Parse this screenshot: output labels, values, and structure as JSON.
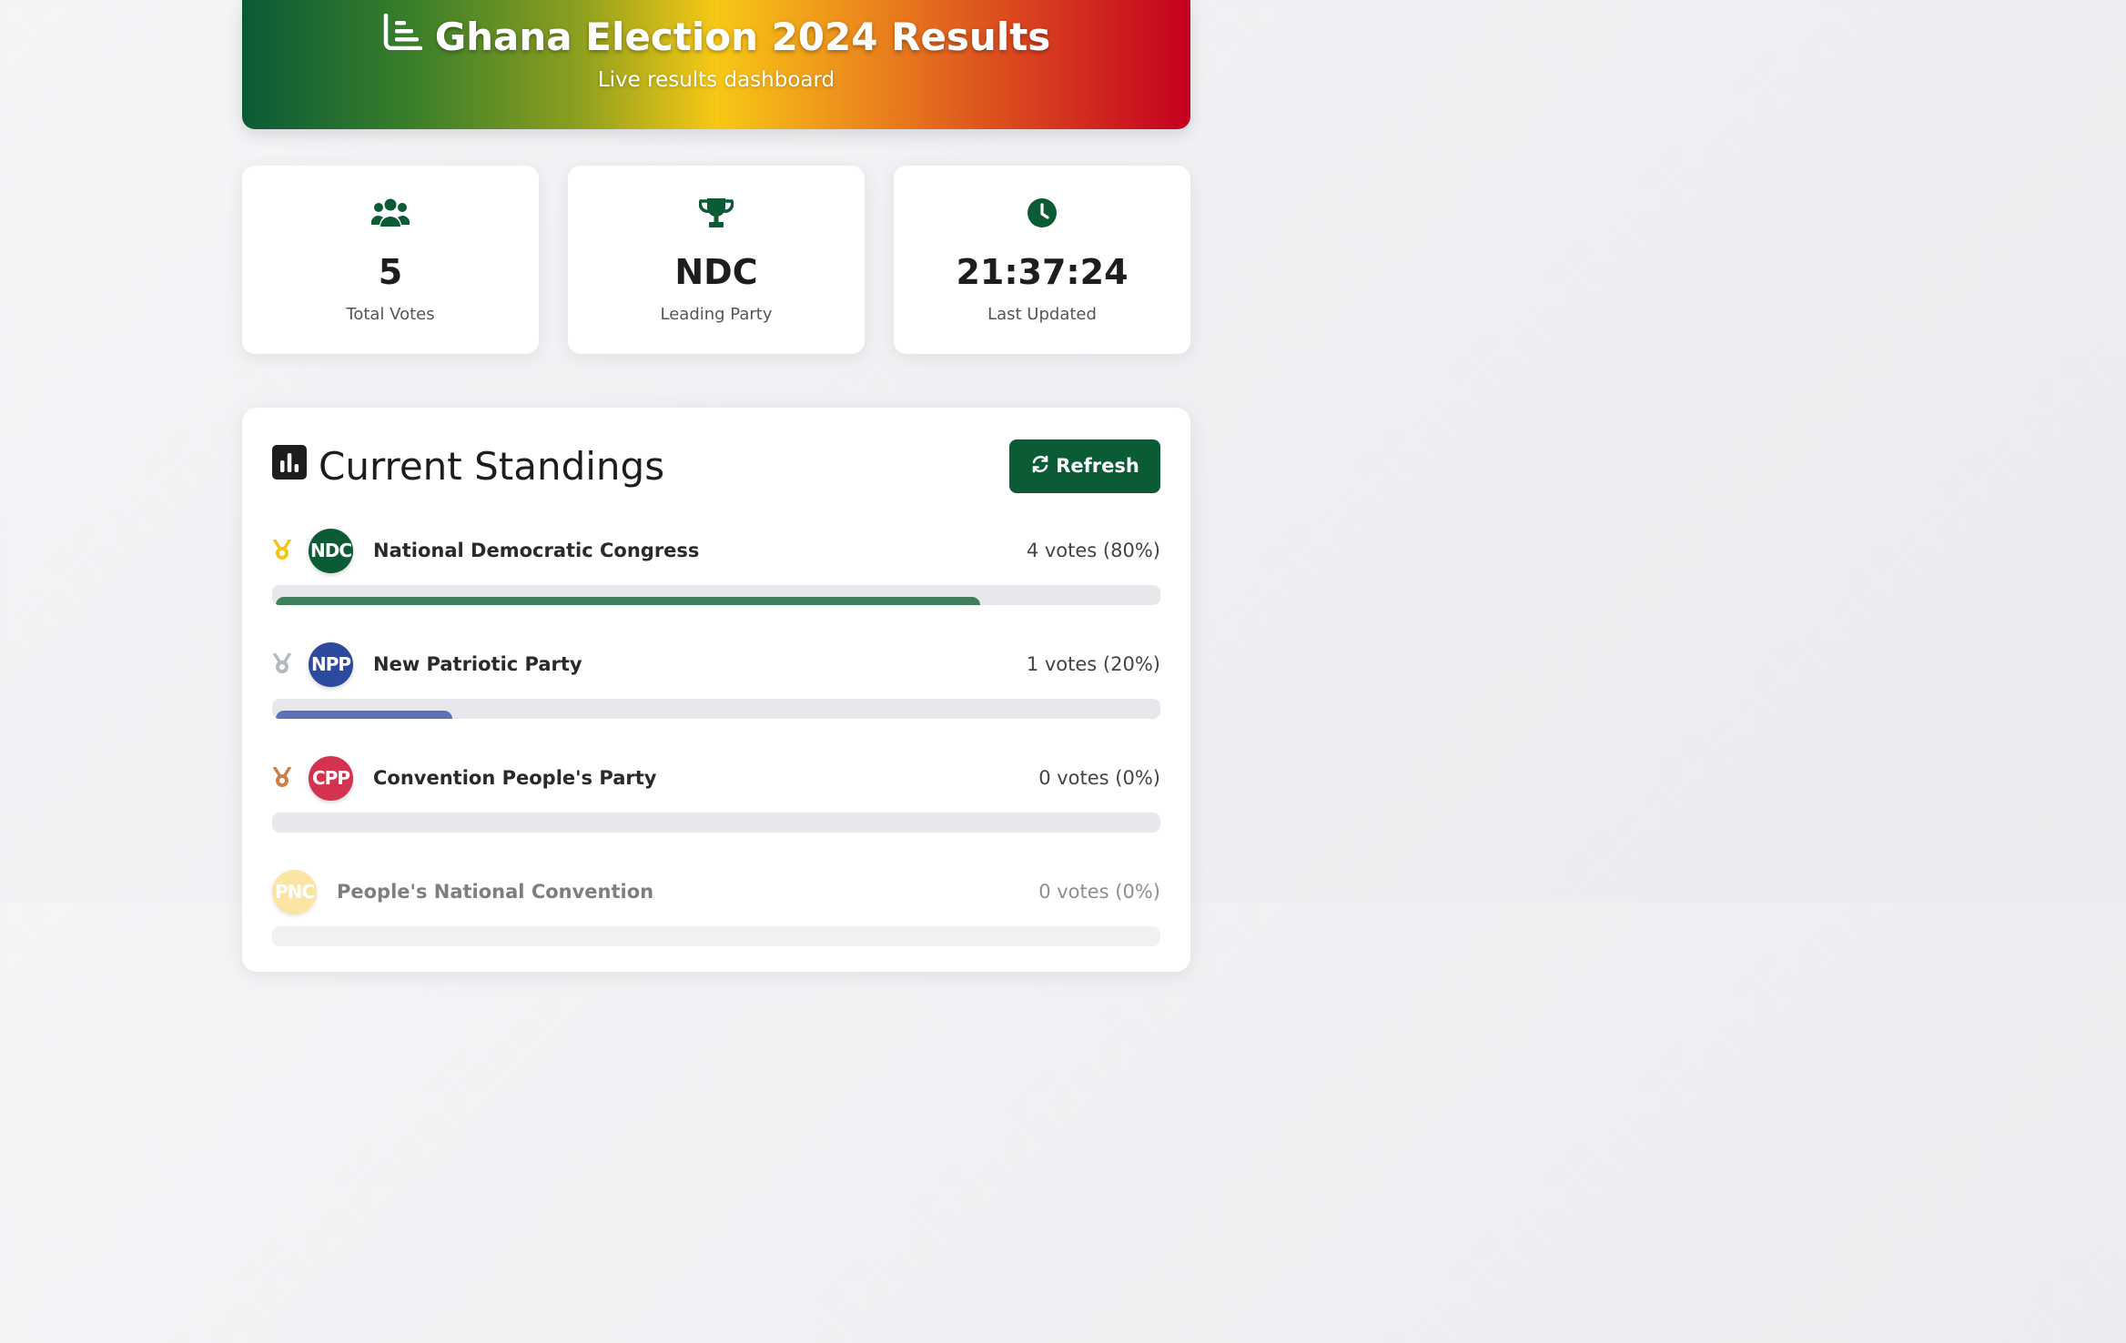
{
  "header": {
    "title": "Ghana Election 2024 Results",
    "subtitle": "Live results dashboard"
  },
  "stats": [
    {
      "icon": "users-icon",
      "value": "5",
      "label": "Total Votes"
    },
    {
      "icon": "trophy-icon",
      "value": "NDC",
      "label": "Leading Party"
    },
    {
      "icon": "clock-icon",
      "value": "21:37:24",
      "label": "Last Updated"
    }
  ],
  "standings": {
    "title": "Current Standings",
    "refresh_label": "Refresh",
    "parties": [
      {
        "abbr": "NDC",
        "name": "National Democratic Congress",
        "votes": "4 votes (80%)",
        "percent": 80,
        "medal": "gold-medal-icon",
        "color": "#0b5c35",
        "bar_color": "#3f7f5a"
      },
      {
        "abbr": "NPP",
        "name": "New Patriotic Party",
        "votes": "1 votes (20%)",
        "percent": 20,
        "medal": "silver-medal-icon",
        "color": "#2b4aa0",
        "bar_color": "#5a72b8"
      },
      {
        "abbr": "CPP",
        "name": "Convention People's Party",
        "votes": "0 votes (0%)",
        "percent": 0,
        "medal": "bronze-medal-icon",
        "color": "#d4334f",
        "bar_color": "#d4334f"
      },
      {
        "abbr": "PNC",
        "name": "People's National Convention",
        "votes": "0 votes (0%)",
        "percent": 0,
        "medal": null,
        "color": "#f7d766",
        "bar_color": "#f7d766"
      }
    ]
  }
}
